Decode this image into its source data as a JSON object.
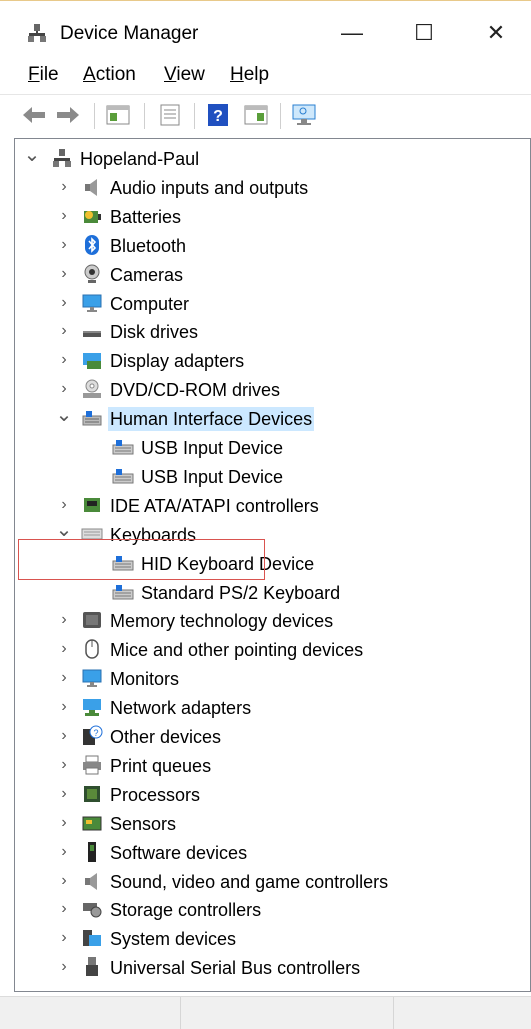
{
  "window": {
    "title": "Device Manager",
    "minimize": "—",
    "maximize": "☐",
    "close": "✕"
  },
  "menu": [
    {
      "u": "F",
      "rest": "ile"
    },
    {
      "u": "A",
      "rest": "ction"
    },
    {
      "u": "V",
      "rest": "iew"
    },
    {
      "u": "H",
      "rest": "elp"
    }
  ],
  "tree": {
    "root": "Hopeland-Paul",
    "items": [
      {
        "label": "Audio inputs and outputs",
        "icon": "speaker-icon"
      },
      {
        "label": "Batteries",
        "icon": "battery-icon"
      },
      {
        "label": "Bluetooth",
        "icon": "bluetooth-icon"
      },
      {
        "label": "Cameras",
        "icon": "camera-icon"
      },
      {
        "label": "Computer",
        "icon": "monitor-icon"
      },
      {
        "label": "Disk drives",
        "icon": "disk-icon"
      },
      {
        "label": "Display adapters",
        "icon": "display-adapter-icon"
      },
      {
        "label": "DVD/CD-ROM drives",
        "icon": "dvd-icon"
      },
      {
        "label": "Human Interface Devices",
        "icon": "hid-icon",
        "expanded": true,
        "selected": true,
        "children": [
          {
            "label": "USB Input Device"
          },
          {
            "label": "USB Input Device"
          }
        ]
      },
      {
        "label": "IDE ATA/ATAPI controllers",
        "icon": "ide-icon"
      },
      {
        "label": "Keyboards",
        "icon": "keyboard-icon",
        "expanded": true,
        "children": [
          {
            "label": "HID Keyboard Device"
          },
          {
            "label": "Standard PS/2 Keyboard"
          }
        ]
      },
      {
        "label": "Memory technology devices",
        "icon": "memory-icon"
      },
      {
        "label": "Mice and other pointing devices",
        "icon": "mouse-icon"
      },
      {
        "label": "Monitors",
        "icon": "monitor-icon"
      },
      {
        "label": "Network adapters",
        "icon": "network-icon"
      },
      {
        "label": "Other devices",
        "icon": "unknown-device-icon"
      },
      {
        "label": "Print queues",
        "icon": "printer-icon"
      },
      {
        "label": "Processors",
        "icon": "cpu-icon"
      },
      {
        "label": "Sensors",
        "icon": "sensor-icon"
      },
      {
        "label": "Software devices",
        "icon": "software-device-icon"
      },
      {
        "label": "Sound, video and game controllers",
        "icon": "speaker-icon"
      },
      {
        "label": "Storage controllers",
        "icon": "storage-icon"
      },
      {
        "label": "System devices",
        "icon": "system-icon"
      },
      {
        "label": "Universal Serial Bus controllers",
        "icon": "usb-icon"
      }
    ]
  },
  "colors": {
    "selection": "#cce8ff",
    "highlight_box": "#d9534f",
    "accent_blue": "#1e90ff"
  }
}
